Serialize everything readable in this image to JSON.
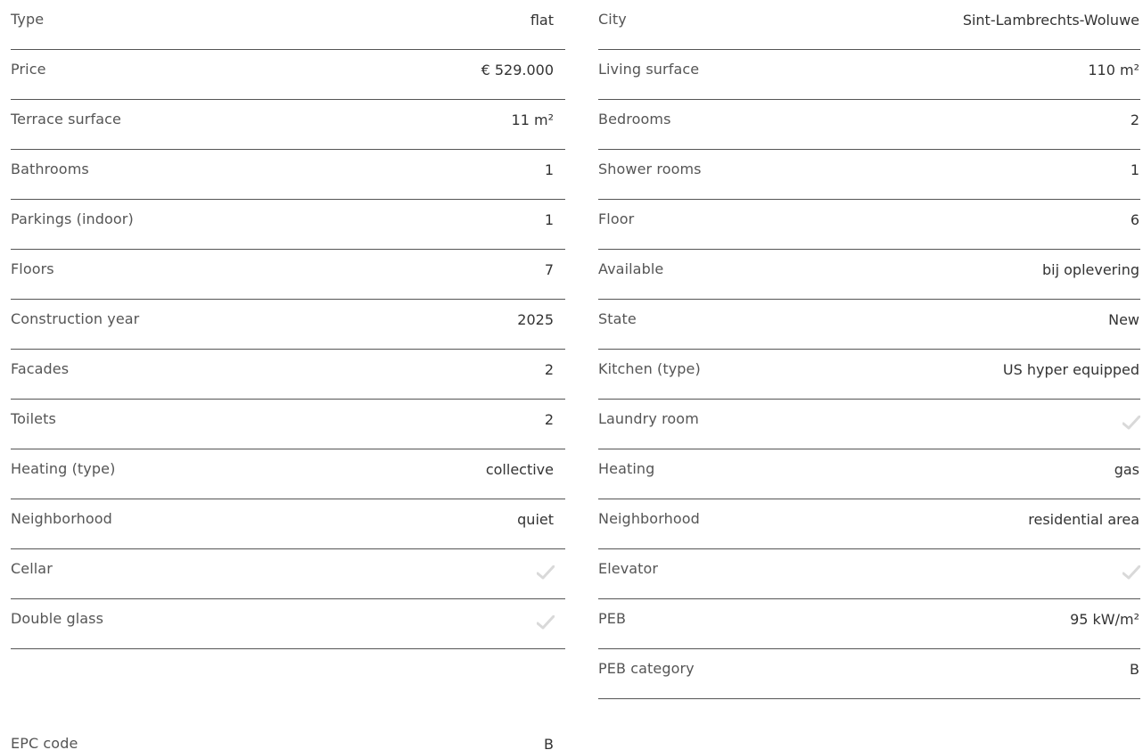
{
  "left_column": [
    {
      "label": "Type",
      "value": "flat"
    },
    {
      "label": "Price",
      "value": "€ 529.000"
    },
    {
      "label": "Terrace surface",
      "value": "11 m²"
    },
    {
      "label": "Bathrooms",
      "value": "1"
    },
    {
      "label": "Parkings (indoor)",
      "value": "1"
    },
    {
      "label": "Floors",
      "value": "7"
    },
    {
      "label": "Construction year",
      "value": "2025"
    },
    {
      "label": "Facades",
      "value": "2"
    },
    {
      "label": "Toilets",
      "value": "2"
    },
    {
      "label": "Heating (type)",
      "value": "collective"
    },
    {
      "label": "Neighborhood",
      "value": "quiet"
    },
    {
      "label": "Cellar",
      "value": "",
      "check": true
    },
    {
      "label": "Double glass",
      "value": "",
      "check": true
    }
  ],
  "epc": {
    "label": "EPC code",
    "value": "B"
  },
  "right_column": [
    {
      "label": "City",
      "value": "Sint-Lambrechts-Woluwe"
    },
    {
      "label": "Living surface",
      "value": "110 m²"
    },
    {
      "label": "Bedrooms",
      "value": "2"
    },
    {
      "label": "Shower rooms",
      "value": "1"
    },
    {
      "label": "Floor",
      "value": "6"
    },
    {
      "label": "Available",
      "value": "bij oplevering"
    },
    {
      "label": "State",
      "value": "New"
    },
    {
      "label": "Kitchen (type)",
      "value": "US hyper equipped"
    },
    {
      "label": "Laundry room",
      "value": "",
      "check": true
    },
    {
      "label": "Heating",
      "value": "gas"
    },
    {
      "label": "Neighborhood",
      "value": "residential area"
    },
    {
      "label": "Elevator",
      "value": "",
      "check": true
    },
    {
      "label": "PEB",
      "value": "95 kW/m²"
    },
    {
      "label": "PEB category",
      "value": "B"
    }
  ],
  "check_icon": "checkmark-icon",
  "check_color": "#d9d9d9"
}
